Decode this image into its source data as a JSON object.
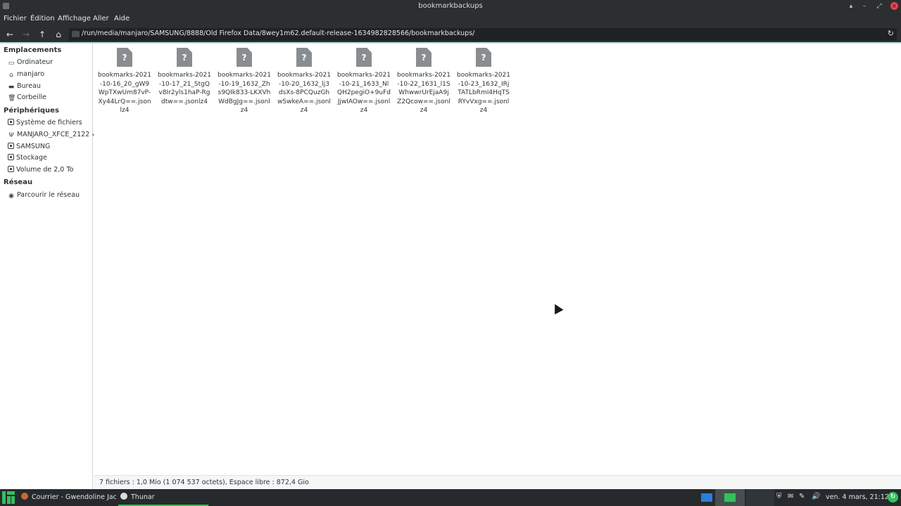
{
  "window": {
    "title": "bookmarkbackups",
    "controls": {
      "shade": "▴",
      "minimize": "–",
      "maximize": "⤢",
      "close": "×"
    }
  },
  "menu": [
    "Fichier",
    "Édition",
    "Affichage",
    "Aller",
    "Aide"
  ],
  "toolbar": {
    "back": "←",
    "forward": "→",
    "up": "↑",
    "home": "⌂",
    "path": "/run/media/manjaro/SAMSUNG/8888/Old Firefox Data/8wey1m62.default-release-1634982828566/bookmarkbackups/",
    "reload": "↻"
  },
  "sidebar": {
    "places_header": "Emplacements",
    "places": [
      {
        "label": "Ordinateur",
        "icon": "computer-icon",
        "glyph": "▭"
      },
      {
        "label": "manjaro",
        "icon": "home-icon",
        "glyph": "⌂"
      },
      {
        "label": "Bureau",
        "icon": "desktop-icon",
        "glyph": "▬"
      },
      {
        "label": "Corbeille",
        "icon": "trash-icon",
        "glyph": "🗑"
      }
    ],
    "devices_header": "Périphériques",
    "devices": [
      {
        "label": "Système de fichiers",
        "icon": "drive-icon",
        "glyph": ""
      },
      {
        "label": "MANJARO_XFCE_2122",
        "icon": "usb-icon",
        "glyph": "Ψ",
        "eject": "⏏"
      },
      {
        "label": "SAMSUNG",
        "icon": "drive-icon",
        "glyph": ""
      },
      {
        "label": "Stockage",
        "icon": "drive-icon",
        "glyph": ""
      },
      {
        "label": "Volume de 2,0 To",
        "icon": "drive-icon",
        "glyph": ""
      }
    ],
    "network_header": "Réseau",
    "network": [
      {
        "label": "Parcourir le réseau",
        "icon": "network-icon",
        "glyph": "◉"
      }
    ]
  },
  "files": [
    {
      "name": "bookmarks-2021-10-16_20_gW9WpTXwUm87vP-Xy44LrQ==.jsonlz4"
    },
    {
      "name": "bookmarks-2021-10-17_21_StgQv8Ir2yls1haP-Rgdtw==.jsonlz4"
    },
    {
      "name": "bookmarks-2021-10-19_1632_Zhs9QIk833-LKXVhWdBgJg==.jsonlz4"
    },
    {
      "name": "bookmarks-2021-10-20_1632_lj3dsXs-8PCQuzGhwSwkeA==.jsonlz4"
    },
    {
      "name": "bookmarks-2021-10-21_1633_NlQH2pegiO+9uFdJjwIAOw==.jsonlz4"
    },
    {
      "name": "bookmarks-2021-10-22_1631_l1SWhwwrUrEjaA9jZ2Qcow==.jsonlz4"
    },
    {
      "name": "bookmarks-2021-10-23_1632_IRjTATLbRmI4HqTSRYvVxg==.jsonlz4"
    }
  ],
  "file_icon_glyph": "?",
  "status": "7 fichiers : 1,0 Mio (1 074 537 octets), Espace libre : 872,4 Gio",
  "taskbar": {
    "tasks": [
      {
        "label": "Courrier - Gwendoline Jaci...",
        "icon": "thunderbird-icon"
      },
      {
        "label": "Thunar",
        "icon": "thunar-icon"
      }
    ],
    "clock": "ven. 4 mars, 21:12",
    "update_glyph": "↻",
    "colors": {
      "accent": "#35bf5c",
      "workspace": "#2b7fd8"
    }
  }
}
